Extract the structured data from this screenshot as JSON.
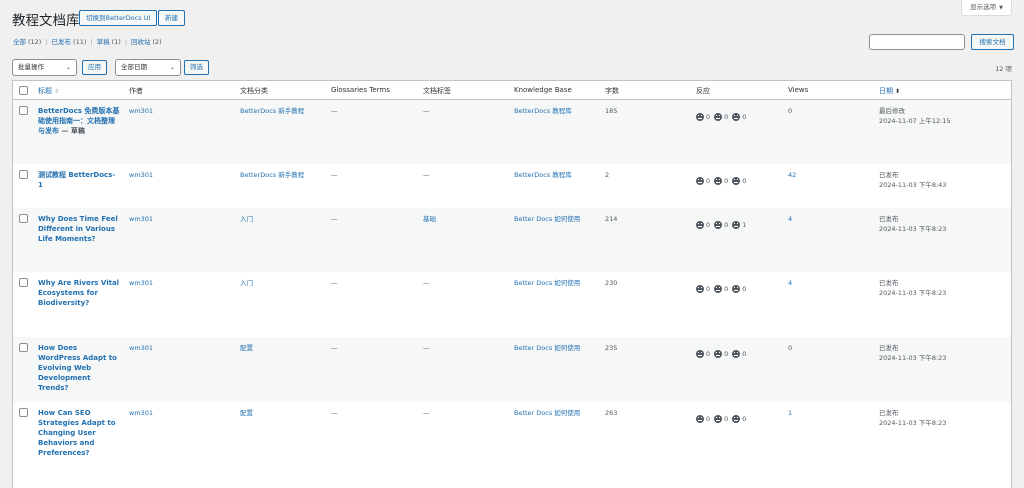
{
  "screen_options": {
    "label": "显示选项",
    "arrow": "▼"
  },
  "header": {
    "title": "教程文档库",
    "switch_ui_label": "切换到BetterDocs UI",
    "add_new_label": "新建"
  },
  "views": [
    {
      "label": "全部",
      "count": "(12)"
    },
    {
      "label": "已发布",
      "count": "(11)"
    },
    {
      "label": "草稿",
      "count": "(1)"
    },
    {
      "label": "回收站",
      "count": "(2)"
    }
  ],
  "search": {
    "value": "",
    "button_label": "搜索文档"
  },
  "filters": {
    "bulk_action": "批量操作",
    "apply_label": "应用",
    "date_filter": "全部日期",
    "filter_label": "筛选",
    "item_count": "12 项"
  },
  "columns": {
    "title": "标题",
    "author": "作者",
    "category": "文档分类",
    "glossaries": "Glossaries Terms",
    "tags": "文档标签",
    "kb": "Knowledge Base",
    "words": "字数",
    "reactions": "反应",
    "views": "Views",
    "date": "日期"
  },
  "rows": [
    {
      "title": "BetterDocs 免费版本基础使用指南一：文档整理与发布",
      "draft_suffix": " — 草稿",
      "author": "wm301",
      "category": "BetterDocs 新手教程",
      "glossaries": "—",
      "tags": "—",
      "kb": "BetterDocs 教程库",
      "words": "185",
      "r1": "0",
      "r2": "0",
      "r3": "0",
      "views": "0",
      "status": "最后修改",
      "date": "2024-11-07 上午12:15"
    },
    {
      "title": "测试教程 BetterDocs-1",
      "draft_suffix": "",
      "author": "wm301",
      "category": "BetterDocs 新手教程",
      "glossaries": "—",
      "tags": "—",
      "kb": "BetterDocs 教程库",
      "words": "2",
      "r1": "0",
      "r2": "0",
      "r3": "0",
      "views": "42",
      "status": "已发布",
      "date": "2024-11-03 下午8:43"
    },
    {
      "title": "Why Does Time Feel Different in Various Life Moments?",
      "draft_suffix": "",
      "author": "wm301",
      "category": "入门",
      "glossaries": "—",
      "tags": "基础",
      "kb": "Better Docs 如何使用",
      "words": "214",
      "r1": "0",
      "r2": "0",
      "r3": "1",
      "views": "4",
      "status": "已发布",
      "date": "2024-11-03 下午8:23"
    },
    {
      "title": "Why Are Rivers Vital Ecosystems for Biodiversity?",
      "draft_suffix": "",
      "author": "wm301",
      "category": "入门",
      "glossaries": "—",
      "tags": "—",
      "kb": "Better Docs 如何使用",
      "words": "230",
      "r1": "0",
      "r2": "0",
      "r3": "0",
      "views": "4",
      "status": "已发布",
      "date": "2024-11-03 下午8:23"
    },
    {
      "title": "How Does WordPress Adapt to Evolving Web Development Trends?",
      "draft_suffix": "",
      "author": "wm301",
      "category": "配置",
      "glossaries": "—",
      "tags": "—",
      "kb": "Better Docs 如何使用",
      "words": "235",
      "r1": "0",
      "r2": "0",
      "r3": "0",
      "views": "0",
      "status": "已发布",
      "date": "2024-11-03 下午8:23"
    },
    {
      "title": "How Can SEO Strategies Adapt to Changing User Behaviors and Preferences?",
      "draft_suffix": "",
      "author": "wm301",
      "category": "配置",
      "glossaries": "—",
      "tags": "—",
      "kb": "Better Docs 如何使用",
      "words": "263",
      "r1": "0",
      "r2": "0",
      "r3": "0",
      "views": "1",
      "status": "已发布",
      "date": "2024-11-03 下午8:23"
    }
  ],
  "icons": {
    "reaction": "face-icon",
    "sort": "sort-arrows-icon",
    "sort_desc": "sort-desc-icon"
  }
}
